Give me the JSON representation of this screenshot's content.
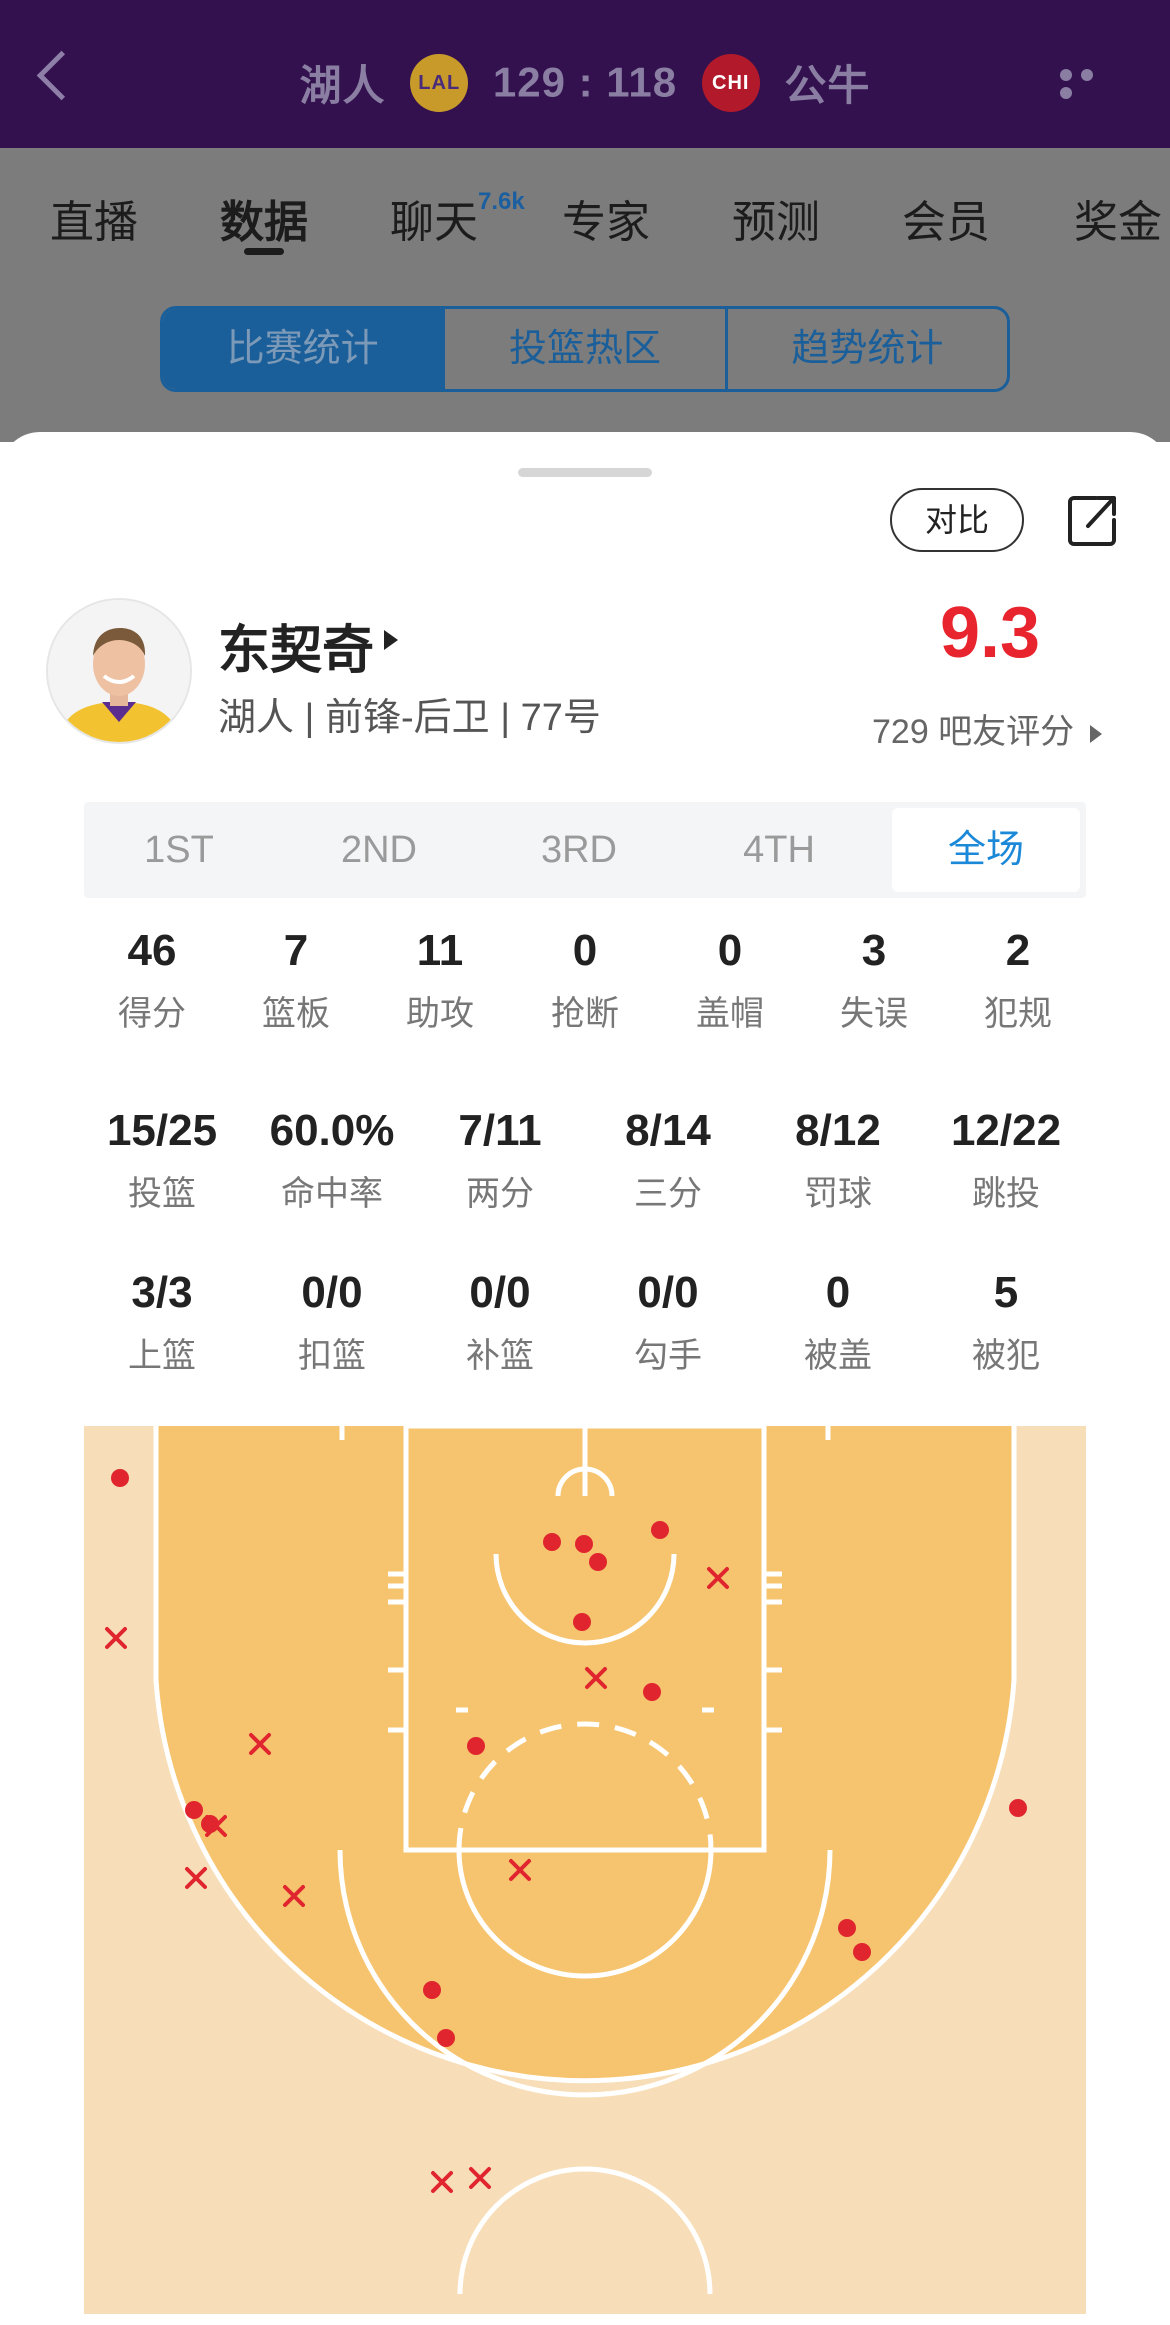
{
  "header": {
    "home_team": "湖人",
    "home_logo": "LAL",
    "score": "129 : 118",
    "away_logo": "CHI",
    "away_team": "公牛"
  },
  "tabs": [
    {
      "label": "直播"
    },
    {
      "label": "数据"
    },
    {
      "label": "聊天"
    },
    {
      "label": "专家"
    },
    {
      "label": "预测"
    },
    {
      "label": "会员"
    },
    {
      "label": "奖金"
    }
  ],
  "chat_badge": "7.6k",
  "segments": [
    "比赛统计",
    "投篮热区",
    "趋势统计"
  ],
  "compare_label": "对比",
  "player": {
    "name": "东契奇",
    "meta": "湖人 | 前锋-后卫 | 77号",
    "rating": "9.3",
    "rating_count": "729 吧友评分"
  },
  "periods": [
    "1ST",
    "2ND",
    "3RD",
    "4TH",
    "全场"
  ],
  "stats_row1": [
    {
      "value": "46",
      "label": "得分"
    },
    {
      "value": "7",
      "label": "篮板"
    },
    {
      "value": "11",
      "label": "助攻"
    },
    {
      "value": "0",
      "label": "抢断"
    },
    {
      "value": "0",
      "label": "盖帽"
    },
    {
      "value": "3",
      "label": "失误"
    },
    {
      "value": "2",
      "label": "犯规"
    }
  ],
  "stats_row2": [
    {
      "value": "15/25",
      "label": "投篮"
    },
    {
      "value": "60.0%",
      "label": "命中率"
    },
    {
      "value": "7/11",
      "label": "两分"
    },
    {
      "value": "8/14",
      "label": "三分"
    },
    {
      "value": "8/12",
      "label": "罚球"
    },
    {
      "value": "12/22",
      "label": "跳投"
    }
  ],
  "stats_row3": [
    {
      "value": "3/3",
      "label": "上篮"
    },
    {
      "value": "0/0",
      "label": "扣篮"
    },
    {
      "value": "0/0",
      "label": "补篮"
    },
    {
      "value": "0/0",
      "label": "勾手"
    },
    {
      "value": "0",
      "label": "被盖"
    },
    {
      "value": "5",
      "label": "被犯"
    }
  ],
  "colors": {
    "header_bg": "#33114e",
    "rating": "#e8242e",
    "active_period": "#1b88d8",
    "court_inner": "#f6c46e",
    "court_outer": "#f8deb8",
    "made_shot": "#e0252f",
    "missed_shot": "#e0252f"
  }
}
